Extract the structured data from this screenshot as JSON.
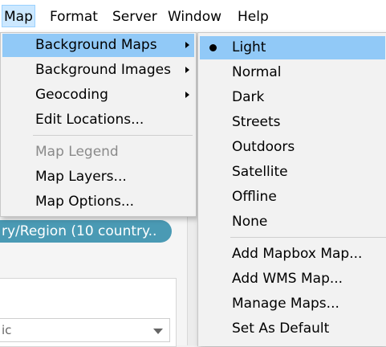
{
  "menubar": {
    "items": [
      "Map",
      "Format",
      "Server",
      "Window",
      "Help"
    ]
  },
  "map_menu": {
    "items": [
      {
        "label": "Background Maps",
        "has_submenu": true,
        "highlighted": true
      },
      {
        "label": "Background Images",
        "has_submenu": true
      },
      {
        "label": "Geocoding",
        "has_submenu": true
      },
      {
        "label": "Edit Locations..."
      },
      {
        "label": "Map Legend",
        "disabled": true
      },
      {
        "label": "Map Layers..."
      },
      {
        "label": "Map Options..."
      }
    ]
  },
  "background_maps_submenu": {
    "items": [
      {
        "label": "Light",
        "selected": true,
        "highlighted": true
      },
      {
        "label": "Normal"
      },
      {
        "label": "Dark"
      },
      {
        "label": "Streets"
      },
      {
        "label": "Outdoors"
      },
      {
        "label": "Satellite"
      },
      {
        "label": "Offline"
      },
      {
        "label": "None"
      },
      {
        "label": "Add Mapbox Map..."
      },
      {
        "label": "Add WMS Map..."
      },
      {
        "label": "Manage Maps..."
      },
      {
        "label": "Set As Default"
      }
    ]
  },
  "background": {
    "pill_text": "ry/Region (10 country..",
    "combo_text": "ic"
  },
  "colors": {
    "highlight": "#91c9f7",
    "pill": "#4a9ab4",
    "menu_bg": "#f2f2f2"
  }
}
